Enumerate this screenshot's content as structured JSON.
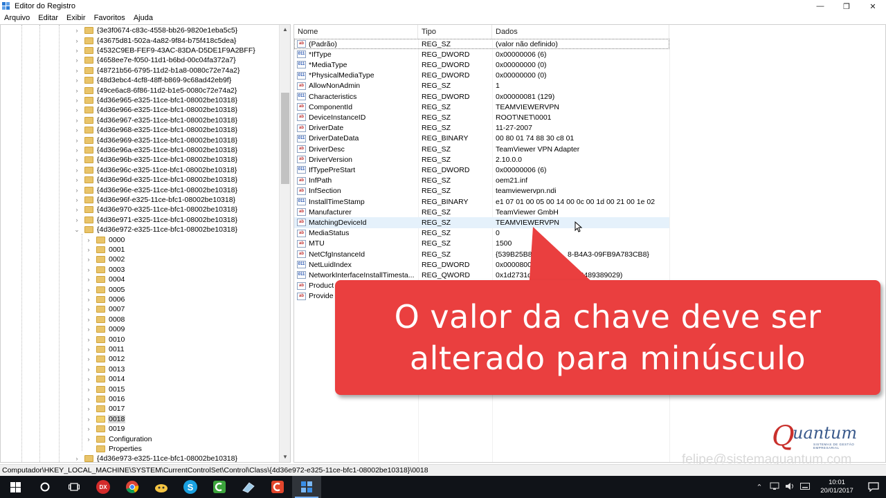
{
  "window": {
    "title": "Editor do Registro",
    "controls": {
      "minimize": "—",
      "maximize": "❐",
      "close": "✕"
    }
  },
  "menu": [
    "Arquivo",
    "Editar",
    "Exibir",
    "Favoritos",
    "Ajuda"
  ],
  "tree": {
    "keys": [
      "{3e3f0674-c83c-4558-bb26-9820e1eba5c5}",
      "{43675d81-502a-4a82-9f84-b75f418c5dea}",
      "{4532C9EB-FEF9-43AC-83DA-D5DE1F9A2BFF}",
      "{4658ee7e-f050-11d1-b6bd-00c04fa372a7}",
      "{48721b56-6795-11d2-b1a8-0080c72e74a2}",
      "{48d3ebc4-4cf8-48ff-b869-9c68ad42eb9f}",
      "{49ce6ac8-6f86-11d2-b1e5-0080c72e74a2}",
      "{4d36e965-e325-11ce-bfc1-08002be10318}",
      "{4d36e966-e325-11ce-bfc1-08002be10318}",
      "{4d36e967-e325-11ce-bfc1-08002be10318}",
      "{4d36e968-e325-11ce-bfc1-08002be10318}",
      "{4d36e969-e325-11ce-bfc1-08002be10318}",
      "{4d36e96a-e325-11ce-bfc1-08002be10318}",
      "{4d36e96b-e325-11ce-bfc1-08002be10318}",
      "{4d36e96c-e325-11ce-bfc1-08002be10318}",
      "{4d36e96d-e325-11ce-bfc1-08002be10318}",
      "{4d36e96e-e325-11ce-bfc1-08002be10318}",
      "{4d36e96f-e325-11ce-bfc1-08002be10318}",
      "{4d36e970-e325-11ce-bfc1-08002be10318}",
      "{4d36e971-e325-11ce-bfc1-08002be10318}"
    ],
    "expanded_key": "{4d36e972-e325-11ce-bfc1-08002be10318}",
    "children": [
      "0000",
      "0001",
      "0002",
      "0003",
      "0004",
      "0005",
      "0006",
      "0007",
      "0008",
      "0009",
      "0010",
      "0011",
      "0012",
      "0013",
      "0014",
      "0015",
      "0016",
      "0017",
      "0018",
      "0019",
      "Configuration",
      "Properties"
    ],
    "selected_child": "0018",
    "last_key": "{4d36e973-e325-11ce-bfc1-08002be10318}"
  },
  "values": {
    "columns": {
      "name": "Nome",
      "type": "Tipo",
      "data": "Dados"
    },
    "rows": [
      {
        "name": "(Padrão)",
        "type": "REG_SZ",
        "data": "(valor não definido)",
        "icon": "string-value-icon"
      },
      {
        "name": "*IfType",
        "type": "REG_DWORD",
        "data": "0x00000006 (6)",
        "icon": "binary-value-icon"
      },
      {
        "name": "*MediaType",
        "type": "REG_DWORD",
        "data": "0x00000000 (0)",
        "icon": "binary-value-icon"
      },
      {
        "name": "*PhysicalMediaType",
        "type": "REG_DWORD",
        "data": "0x00000000 (0)",
        "icon": "binary-value-icon"
      },
      {
        "name": "AllowNonAdmin",
        "type": "REG_SZ",
        "data": "1",
        "icon": "string-value-icon"
      },
      {
        "name": "Characteristics",
        "type": "REG_DWORD",
        "data": "0x00000081 (129)",
        "icon": "binary-value-icon"
      },
      {
        "name": "ComponentId",
        "type": "REG_SZ",
        "data": "TEAMVIEWERVPN",
        "icon": "string-value-icon"
      },
      {
        "name": "DeviceInstanceID",
        "type": "REG_SZ",
        "data": "ROOT\\NET\\0001",
        "icon": "string-value-icon"
      },
      {
        "name": "DriverDate",
        "type": "REG_SZ",
        "data": "11-27-2007",
        "icon": "string-value-icon"
      },
      {
        "name": "DriverDateData",
        "type": "REG_BINARY",
        "data": "00 80 01 74 88 30 c8 01",
        "icon": "binary-value-icon"
      },
      {
        "name": "DriverDesc",
        "type": "REG_SZ",
        "data": "TeamViewer VPN Adapter",
        "icon": "string-value-icon"
      },
      {
        "name": "DriverVersion",
        "type": "REG_SZ",
        "data": "2.10.0.0",
        "icon": "string-value-icon"
      },
      {
        "name": "IfTypePreStart",
        "type": "REG_DWORD",
        "data": "0x00000006 (6)",
        "icon": "binary-value-icon"
      },
      {
        "name": "InfPath",
        "type": "REG_SZ",
        "data": "oem21.inf",
        "icon": "string-value-icon"
      },
      {
        "name": "InfSection",
        "type": "REG_SZ",
        "data": "teamviewervpn.ndi",
        "icon": "string-value-icon"
      },
      {
        "name": "InstallTimeStamp",
        "type": "REG_BINARY",
        "data": "e1 07 01 00 05 00 14 00 0c 00 1d 00 21 00 1e 02",
        "icon": "binary-value-icon"
      },
      {
        "name": "Manufacturer",
        "type": "REG_SZ",
        "data": "TeamViewer GmbH",
        "icon": "string-value-icon"
      },
      {
        "name": "MatchingDeviceId",
        "type": "REG_SZ",
        "data": "TEAMVIEWERVPN",
        "icon": "string-value-icon"
      },
      {
        "name": "MediaStatus",
        "type": "REG_SZ",
        "data": "0",
        "icon": "string-value-icon"
      },
      {
        "name": "MTU",
        "type": "REG_SZ",
        "data": "1500",
        "icon": "string-value-icon"
      },
      {
        "name": "NetCfgInstanceId",
        "type": "REG_SZ",
        "data": "{539B25B8-D8",
        "data_tail": "8-B4A3-09FB9A783CB8}",
        "icon": "string-value-icon"
      },
      {
        "name": "NetLuidIndex",
        "type": "REG_DWORD",
        "data": "0x00008007 (327",
        "icon": "binary-value-icon"
      },
      {
        "name": "NetworkInterfaceInstallTimesta...",
        "type": "REG_QWORD",
        "data": "0x1d2731d38aec3",
        "data_tail": "3908489389029)",
        "icon": "binary-value-icon"
      },
      {
        "name": "Product",
        "type": "",
        "data": "",
        "icon": "string-value-icon"
      },
      {
        "name": "Provide",
        "type": "",
        "data": "",
        "icon": "string-value-icon"
      }
    ],
    "hovered_row": "MatchingDeviceId"
  },
  "callout": {
    "line1": "O valor da chave deve ser",
    "line2": "alterado para minúsculo"
  },
  "watermark": {
    "logo_word": "uantum",
    "logo_sub": "SISTEMAS DE GESTÃO EMPRESARIAL",
    "email": "felipe@sistemaquantum.com"
  },
  "statusbar": {
    "path": "Computador\\HKEY_LOCAL_MACHINE\\SYSTEM\\CurrentControlSet\\Control\\Class\\{4d36e972-e325-11ce-bfc1-08002be10318}\\0018"
  },
  "taskbar": {
    "apps": [
      "start-icon",
      "cortana-icon",
      "task-view-icon",
      "dx-app-icon",
      "chrome-icon",
      "squirrel-app-icon",
      "skype-icon",
      "camtasia-recorder-icon",
      "eraser-app-icon",
      "camtasia-icon",
      "regedit-icon"
    ],
    "dx_label": "DX",
    "skype_label": "S",
    "time": "10:01",
    "date": "20/01/2017"
  }
}
